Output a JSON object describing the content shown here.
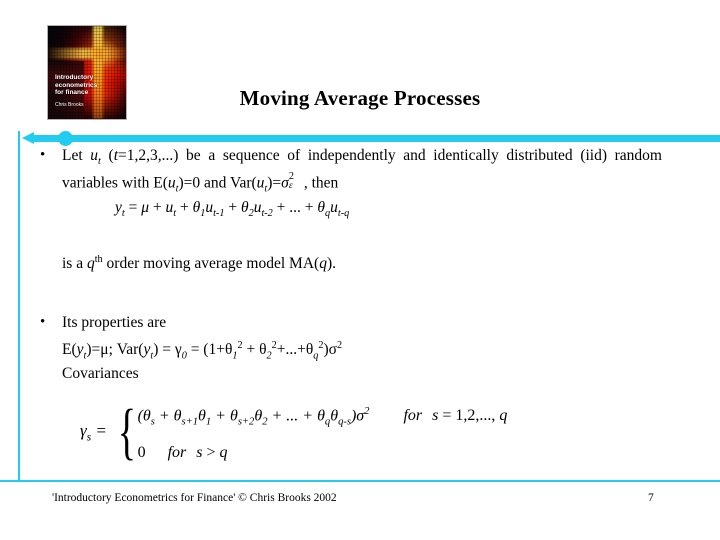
{
  "slide": {
    "title": "Moving Average Processes",
    "page_number": "7",
    "footer": "'Introductory Econometrics for Finance' © Chris Brooks 2002",
    "accent_color": "#22CBF0"
  },
  "cover": {
    "alt": "book-cover",
    "title": "Introductory econometrics for finance",
    "author": "Chris Brooks"
  },
  "bullets": [
    {
      "marker": "•",
      "text_parts": {
        "p1": "Let ",
        "u": "u",
        "t_sub": "t",
        "p2": " (",
        "t_it": "t",
        "p3": "=1,2,3,...)  be  a  sequence  of  independently  and  identically distributed (iid) random variables with E(",
        "u2": "u",
        "t_sub2": "t",
        "p4": ")=0 and Var(",
        "u3": "u",
        "t_sub3": "t",
        "p5": ")=",
        "sigma": "σ",
        "sigma_sup": "2",
        "sigma_sub": "ε",
        "p6": " , then"
      }
    },
    {
      "marker": "•",
      "text": "Its properties are"
    }
  ],
  "equations": {
    "ma_model": {
      "lhs_y": "y",
      "lhs_sub": "t",
      "eq": " = ",
      "mu": "μ",
      "plus": " + ",
      "u": "u",
      "u_sub": "t",
      "theta": "θ",
      "th1_sub": "1",
      "th1_term": "u",
      "th1_term_sub": "t-1",
      "th2_sub": "2",
      "th2_term": "u",
      "th2_term_sub": "t-2",
      "dots": " + ... + ",
      "thq_sub": "q",
      "thq_term": "u",
      "thq_term_sub": "t-q"
    },
    "order_statement": {
      "p1": "is a ",
      "q": "q",
      "th": "th",
      "p2": " order moving average model MA(",
      "q2": "q",
      "p3": ")."
    },
    "properties": {
      "mean_var": {
        "E": "E(",
        "y": "y",
        "y_sub": "t",
        "eq_mu": ")=μ; Var(",
        "y2": "y",
        "y2_sub": "t",
        "eq_gamma": ") = γ",
        "gamma_sub": "0",
        "eq_open": " = (1+θ",
        "th1_sub": "1",
        "th1_sup": "2",
        "plus1": " + θ",
        "th2_sub": "2",
        "th2_sup": "2",
        "plus2": "+...+θ",
        "thq_sub": "q",
        "thq_sup": "2",
        "close": ")σ",
        "close_sup": "2"
      },
      "covariances_label": "Covariances"
    },
    "gamma_piecewise": {
      "lhs_gamma": "γ",
      "lhs_sub": "s",
      "lhs_eq": " = ",
      "case1": {
        "expr_open": "(θ",
        "s_sub": "s",
        "plus1": " + θ",
        "s1_sub": "s+1",
        "th1": "θ",
        "th1_sub": "1",
        "plus2": " + θ",
        "s2_sub": "s+2",
        "th2": "θ",
        "th2_sub": "2",
        "dots": " + ... + θ",
        "q_sub": "q",
        "thq": "θ",
        "thq_sub": "q-s",
        "close": ")σ",
        "close_sup": "2",
        "for": "for",
        "cond_s": "s",
        "cond_rest": " = 1,2,..., ",
        "cond_q": "q"
      },
      "case2": {
        "value": "0",
        "for": "for",
        "cond_s": "s",
        "cond_op": " > ",
        "cond_q": "q"
      }
    }
  }
}
